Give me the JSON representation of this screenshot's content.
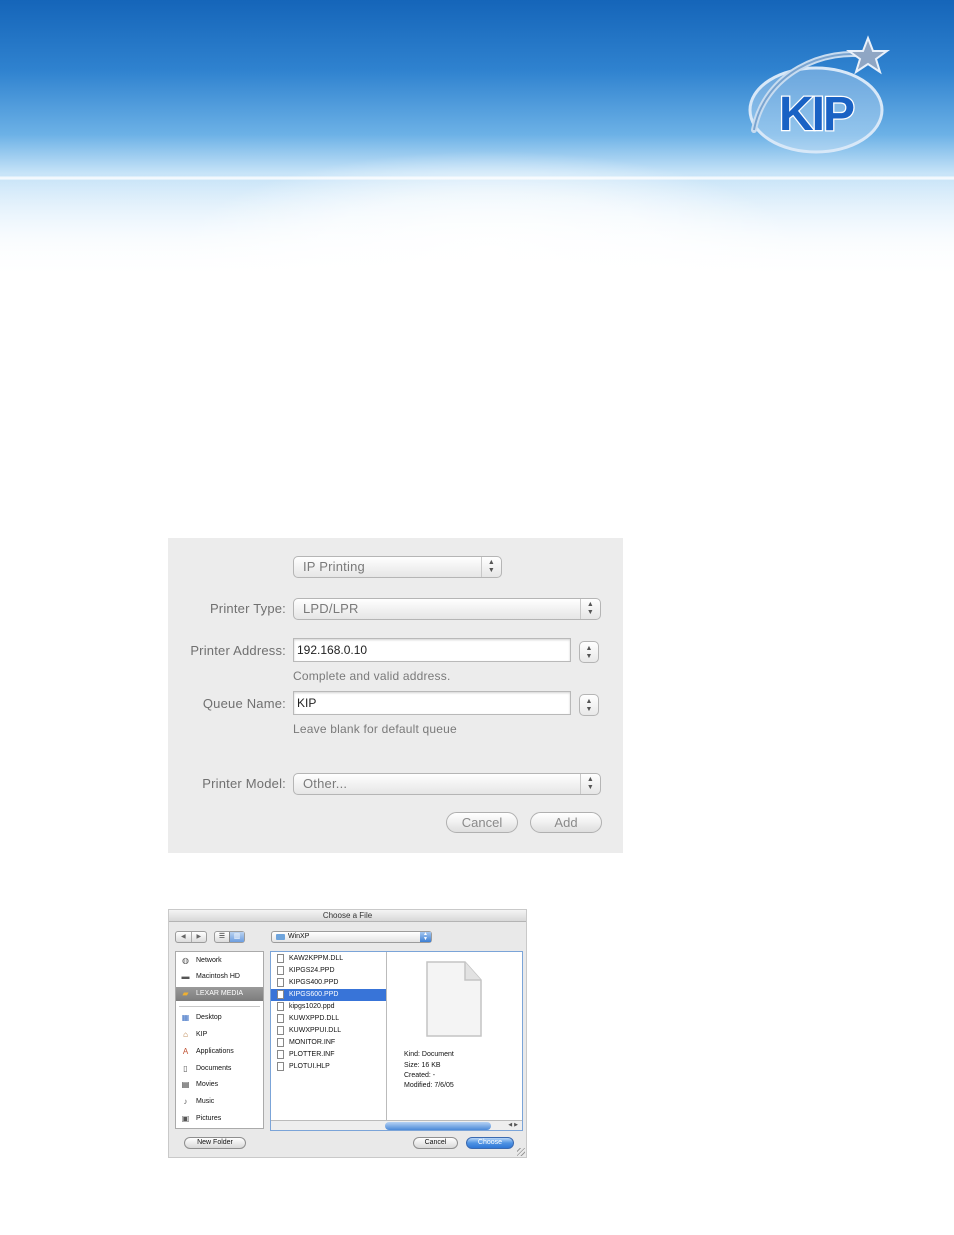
{
  "header": {
    "logo_text": "KIP",
    "colors": {
      "banner_top": "#1565b9",
      "banner_mid": "#6cb1e6",
      "logo_blue": "#1a62c4"
    }
  },
  "printer_dialog": {
    "protocol_popup": "IP Printing",
    "printer_type_label": "Printer Type:",
    "printer_type_value": "LPD/LPR",
    "printer_address_label": "Printer Address:",
    "printer_address_value": "192.168.0.10",
    "printer_address_hint": "Complete and valid address.",
    "queue_name_label": "Queue Name:",
    "queue_name_value": "KIP",
    "queue_name_hint": "Leave blank for default queue",
    "printer_model_label": "Printer Model:",
    "printer_model_value": "Other...",
    "cancel_label": "Cancel",
    "add_label": "Add"
  },
  "file_chooser": {
    "title": "Choose a File",
    "current_folder": "WinXP",
    "sidebar": [
      {
        "label": "Network",
        "icon": "globe-icon"
      },
      {
        "label": "Macintosh HD",
        "icon": "hard-drive-icon"
      },
      {
        "label": "LEXAR MEDIA",
        "icon": "removable-drive-icon",
        "selected": true
      },
      {
        "label": "Desktop",
        "icon": "desktop-icon"
      },
      {
        "label": "KIP",
        "icon": "home-icon"
      },
      {
        "label": "Applications",
        "icon": "applications-icon"
      },
      {
        "label": "Documents",
        "icon": "documents-icon"
      },
      {
        "label": "Movies",
        "icon": "movies-icon"
      },
      {
        "label": "Music",
        "icon": "music-icon"
      },
      {
        "label": "Pictures",
        "icon": "pictures-icon"
      }
    ],
    "files": [
      {
        "name": "KAW2KPPM.DLL"
      },
      {
        "name": "KIPGS24.PPD"
      },
      {
        "name": "KIPGS400.PPD"
      },
      {
        "name": "KIPGS600.PPD",
        "selected": true
      },
      {
        "name": "kipgs1020.ppd"
      },
      {
        "name": "KUWXPPD.DLL"
      },
      {
        "name": "KUWXPPUI.DLL"
      },
      {
        "name": "MONITOR.INF"
      },
      {
        "name": "PLOTTER.INF"
      },
      {
        "name": "PLOTUI.HLP"
      }
    ],
    "preview": {
      "kind": "Kind: Document",
      "size": "Size: 16 KB",
      "created": "Created: -",
      "modified": "Modified: 7/6/05"
    },
    "new_folder_label": "New Folder",
    "cancel_label": "Cancel",
    "choose_label": "Choose"
  }
}
